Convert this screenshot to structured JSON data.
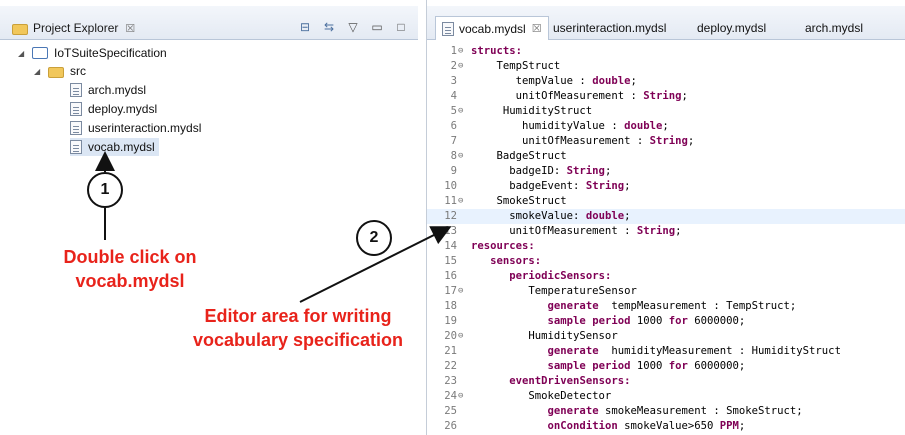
{
  "project_explorer": {
    "tab_title": "Project Explorer",
    "tab_close": "☒",
    "toolbar": [
      "collapse-all",
      "link-with-editor",
      "view-menu",
      "minimize",
      "maximize"
    ],
    "tree": [
      {
        "label": "IoTSuiteSpecification",
        "type": "project",
        "expanded": true
      },
      {
        "label": "src",
        "type": "folder",
        "expanded": true
      },
      {
        "label": "arch.mydsl",
        "type": "file"
      },
      {
        "label": "deploy.mydsl",
        "type": "file"
      },
      {
        "label": "userinteraction.mydsl",
        "type": "file"
      },
      {
        "label": "vocab.mydsl",
        "type": "file",
        "selected": true
      }
    ]
  },
  "annotations": {
    "step1_number": "1",
    "step1_text_line1": "Double click on",
    "step1_text_line2": "vocab.mydsl",
    "step2_number": "2",
    "step2_text_line1": "Editor area for writing",
    "step2_text_line2": "vocabulary specification",
    "color": "#e8231b"
  },
  "editor": {
    "tabs": [
      {
        "label": "vocab.mydsl",
        "active": true,
        "close": "☒"
      },
      {
        "label": "userinteraction.mydsl",
        "active": false
      },
      {
        "label": "deploy.mydsl",
        "active": false
      },
      {
        "label": "arch.mydsl",
        "active": false
      }
    ],
    "lines": [
      {
        "n": "1",
        "fold": "⊖",
        "html": "<span class='kw'>structs:</span>"
      },
      {
        "n": "2",
        "fold": "⊖",
        "html": "    TempStruct"
      },
      {
        "n": "3",
        "fold": "",
        "html": "       tempValue : <span class='kw'>double</span>;"
      },
      {
        "n": "4",
        "fold": "",
        "html": "       unitOfMeasurement : <span class='kw'>String</span>;"
      },
      {
        "n": "5",
        "fold": "⊖",
        "html": "     HumidityStruct"
      },
      {
        "n": "6",
        "fold": "",
        "html": "        humidityValue : <span class='kw'>double</span>;"
      },
      {
        "n": "7",
        "fold": "",
        "html": "        unitOfMeasurement : <span class='kw'>String</span>;"
      },
      {
        "n": "8",
        "fold": "⊖",
        "html": "    BadgeStruct"
      },
      {
        "n": "9",
        "fold": "",
        "html": "      badgeID: <span class='kw'>String</span>;"
      },
      {
        "n": "10",
        "fold": "",
        "html": "      badgeEvent: <span class='kw'>String</span>;"
      },
      {
        "n": "11",
        "fold": "⊖",
        "html": "    SmokeStruct"
      },
      {
        "n": "12",
        "fold": "",
        "html": "      smokeValue: <span class='kw'>double</span>;",
        "highlight": true
      },
      {
        "n": "13",
        "fold": "",
        "html": "      unitOfMeasurement : <span class='kw'>String</span>;"
      },
      {
        "n": "14",
        "fold": "",
        "html": "<span class='kw'>resources:</span>"
      },
      {
        "n": "15",
        "fold": "",
        "html": "   <span class='kw'>sensors:</span>"
      },
      {
        "n": "16",
        "fold": "",
        "html": "      <span class='kw'>periodicSensors:</span>"
      },
      {
        "n": "17",
        "fold": "⊖",
        "html": "         TemperatureSensor"
      },
      {
        "n": "18",
        "fold": "",
        "html": "            <span class='kw'>generate</span>  tempMeasurement : TempStruct;"
      },
      {
        "n": "19",
        "fold": "",
        "html": "            <span class='kw'>sample period</span> 1000 <span class='kw'>for</span> 6000000;"
      },
      {
        "n": "20",
        "fold": "⊖",
        "html": "         HumiditySensor"
      },
      {
        "n": "21",
        "fold": "",
        "html": "            <span class='kw'>generate</span>  humidityMeasurement : HumidityStruct"
      },
      {
        "n": "22",
        "fold": "",
        "html": "            <span class='kw'>sample period</span> 1000 <span class='kw'>for</span> 6000000;"
      },
      {
        "n": "23",
        "fold": "",
        "html": "      <span class='kw'>eventDrivenSensors:</span>"
      },
      {
        "n": "24",
        "fold": "⊖",
        "html": "         SmokeDetector"
      },
      {
        "n": "25",
        "fold": "",
        "html": "            <span class='kw'>generate</span> smokeMeasurement : SmokeStruct;"
      },
      {
        "n": "26",
        "fold": "",
        "html": "            <span class='kw'>onCondition</span> smokeValue&gt;650 <span class='kw'>PPM</span>;"
      }
    ]
  }
}
